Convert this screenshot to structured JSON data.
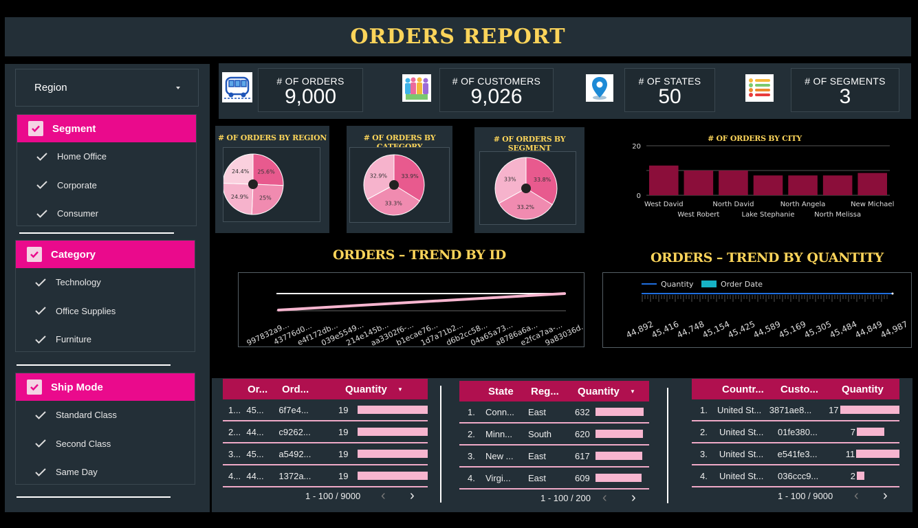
{
  "header": {
    "title": "ORDERS REPORT"
  },
  "sidebar": {
    "dropdown": {
      "label": "Region"
    },
    "filters": [
      {
        "title": "Segment",
        "items": [
          "Home Office",
          "Corporate",
          "Consumer"
        ]
      },
      {
        "title": "Category",
        "items": [
          "Technology",
          "Office Supplies",
          "Furniture"
        ]
      },
      {
        "title": "Ship Mode",
        "items": [
          "Standard Class",
          "Second Class",
          "Same Day"
        ]
      }
    ]
  },
  "kpis": [
    {
      "label": "# OF ORDERS",
      "value": "9,000",
      "icon": "bus-icon"
    },
    {
      "label": "# OF CUSTOMERS",
      "value": "9,026",
      "icon": "people-icon"
    },
    {
      "label": "# OF STATES",
      "value": "50",
      "icon": "location-pin-icon"
    },
    {
      "label": "# OF SEGMENTS",
      "value": "3",
      "icon": "list-icon"
    }
  ],
  "pies": [
    {
      "title": "# OF ORDERS BY REGION",
      "labels": [
        "25.6%",
        "25%",
        "24.9%",
        "24.4%"
      ],
      "values": [
        25.6,
        25,
        24.9,
        24.4
      ]
    },
    {
      "title": "# OF ORDERS BY CATEGORY",
      "labels": [
        "33.9%",
        "33.3%",
        "32.9%"
      ],
      "values": [
        33.9,
        33.3,
        32.9
      ]
    },
    {
      "title": "# OF ORDERS BY SEGMENT",
      "labels": [
        "33.8%",
        "33.2%",
        "33%"
      ],
      "values": [
        33.8,
        33.2,
        33
      ]
    }
  ],
  "colors": {
    "pie": [
      "#e85a8e",
      "#f08bb0",
      "#f6b3cc",
      "#fad0de"
    ],
    "bar": "#8b0e3a",
    "accent": "#fbd45a",
    "pink": "#ea0a8c",
    "tablehead": "#b0104f"
  },
  "chart_data": [
    {
      "type": "bar",
      "title": "# OF ORDERS BY CITY",
      "categories": [
        "West David",
        "West Robert",
        "North David",
        "Lake Stephanie",
        "North Angela",
        "North Melissa",
        "New Michael"
      ],
      "values": [
        12,
        10,
        10,
        8,
        8,
        8,
        9
      ],
      "ylim": [
        0,
        20
      ],
      "yticks": [
        "0",
        "20"
      ]
    },
    {
      "type": "line",
      "title": "ORDERS  – TREND BY ID",
      "x": [
        "997832a9...",
        "43776d0...",
        "e4f172db...",
        "039e5549...",
        "214e145b...",
        "aa3302f6-...",
        "b1ecae76...",
        "1d7a71b2...",
        "d6b2cc58...",
        "04a65a73...",
        "a8786a6a...",
        "e2fca7aa-...",
        "9a83036d..."
      ]
    },
    {
      "type": "line",
      "title": "ORDERS – TREND BY QUANTITY",
      "legend": [
        "Quantity",
        "Order Date"
      ],
      "x": [
        "44,892",
        "45,416",
        "44,748",
        "45,154",
        "45,425",
        "44,589",
        "45,169",
        "45,305",
        "45,484",
        "44,849",
        "44,987"
      ]
    }
  ],
  "tables": [
    {
      "headers": [
        "Or...",
        "Ord...",
        "Quantity"
      ],
      "sort": "▼",
      "rows": [
        [
          "1...",
          "45...",
          "6f7e4...",
          "19"
        ],
        [
          "2...",
          "44...",
          "c9262...",
          "19"
        ],
        [
          "3...",
          "45...",
          "a5492...",
          "19"
        ],
        [
          "4...",
          "44...",
          "1372a...",
          "19"
        ]
      ],
      "bars": [
        19,
        19,
        19,
        19
      ],
      "max": 19,
      "pager": "1 - 100 / 9000"
    },
    {
      "headers": [
        "State",
        "Reg...",
        "Quantity"
      ],
      "sort": "▼",
      "rows": [
        [
          "1.",
          "Conn...",
          "East",
          "632"
        ],
        [
          "2.",
          "Minn...",
          "South",
          "620"
        ],
        [
          "3.",
          "New ...",
          "East",
          "617"
        ],
        [
          "4.",
          "Virgi...",
          "East",
          "609"
        ]
      ],
      "bars": [
        632,
        620,
        617,
        609
      ],
      "max": 632,
      "pager": "1 - 100 / 200"
    },
    {
      "headers": [
        "Countr...",
        "Custo...",
        "Quantity"
      ],
      "sort": "",
      "rows": [
        [
          "1.",
          "United St...",
          "3871ae8...",
          "17"
        ],
        [
          "2.",
          "United St...",
          "01fe380...",
          "7"
        ],
        [
          "3.",
          "United St...",
          "e541fe3...",
          "11"
        ],
        [
          "4.",
          "United St...",
          "036ccc9...",
          "2"
        ]
      ],
      "bars": [
        17,
        7,
        11,
        2
      ],
      "max": 19,
      "pager": "1 - 100 / 9000"
    }
  ]
}
